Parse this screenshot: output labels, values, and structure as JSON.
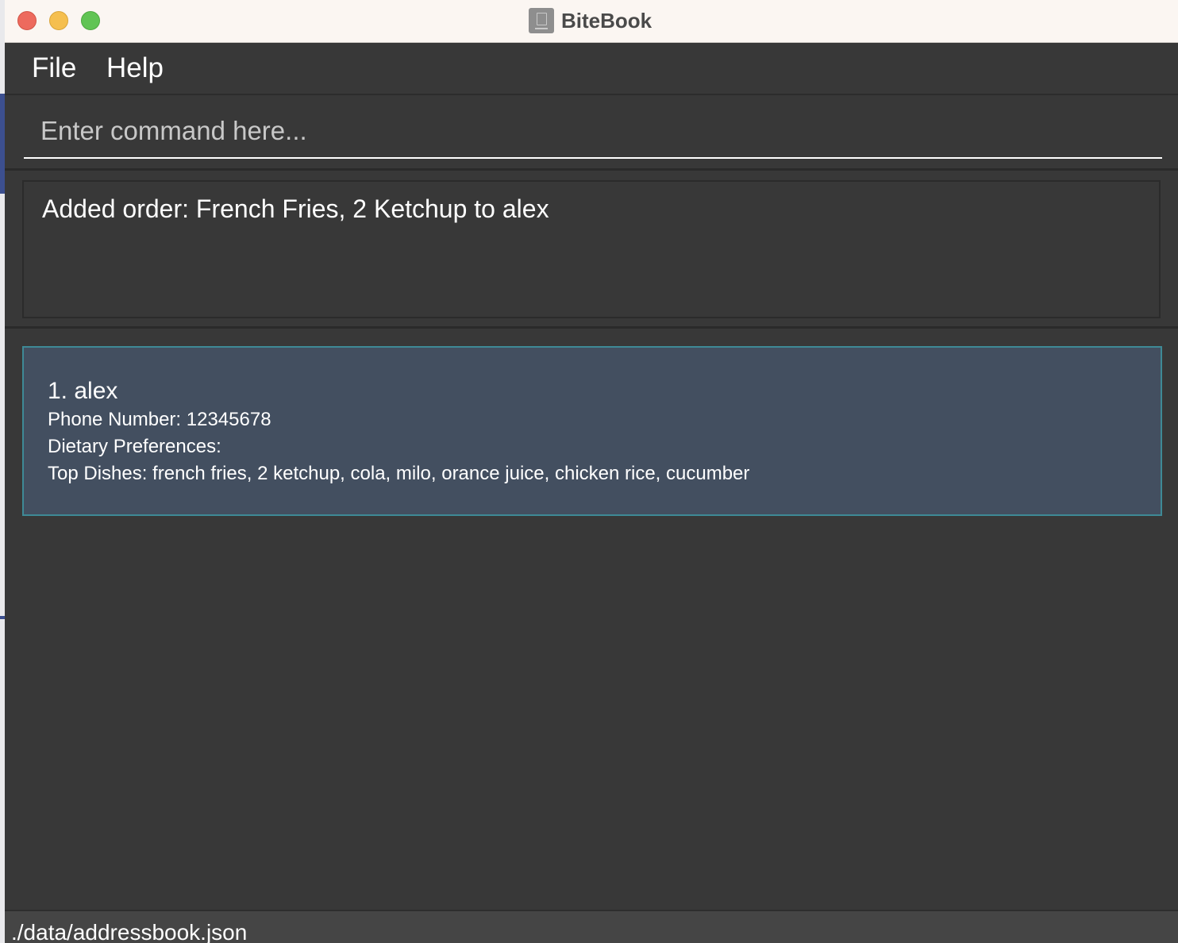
{
  "window": {
    "title": "BiteBook"
  },
  "menu": {
    "file_label": "File",
    "help_label": "Help"
  },
  "command": {
    "placeholder": "Enter command here...",
    "value": ""
  },
  "result": {
    "message": "Added order: French Fries, 2 Ketchup to alex"
  },
  "customers": [
    {
      "index_name": "1. alex",
      "phone": "Phone Number: 12345678",
      "dietary": "Dietary Preferences:",
      "top_dishes": "Top Dishes: french fries, 2 ketchup, cola, milo, orance juice, chicken rice, cucumber"
    }
  ],
  "status": {
    "file_path": "./data/addressbook.json"
  },
  "colors": {
    "window_bg": "#383838",
    "card_bg": "#434f60",
    "card_border": "#3e8a96",
    "titlebar_bg": "#fbf6f2"
  }
}
